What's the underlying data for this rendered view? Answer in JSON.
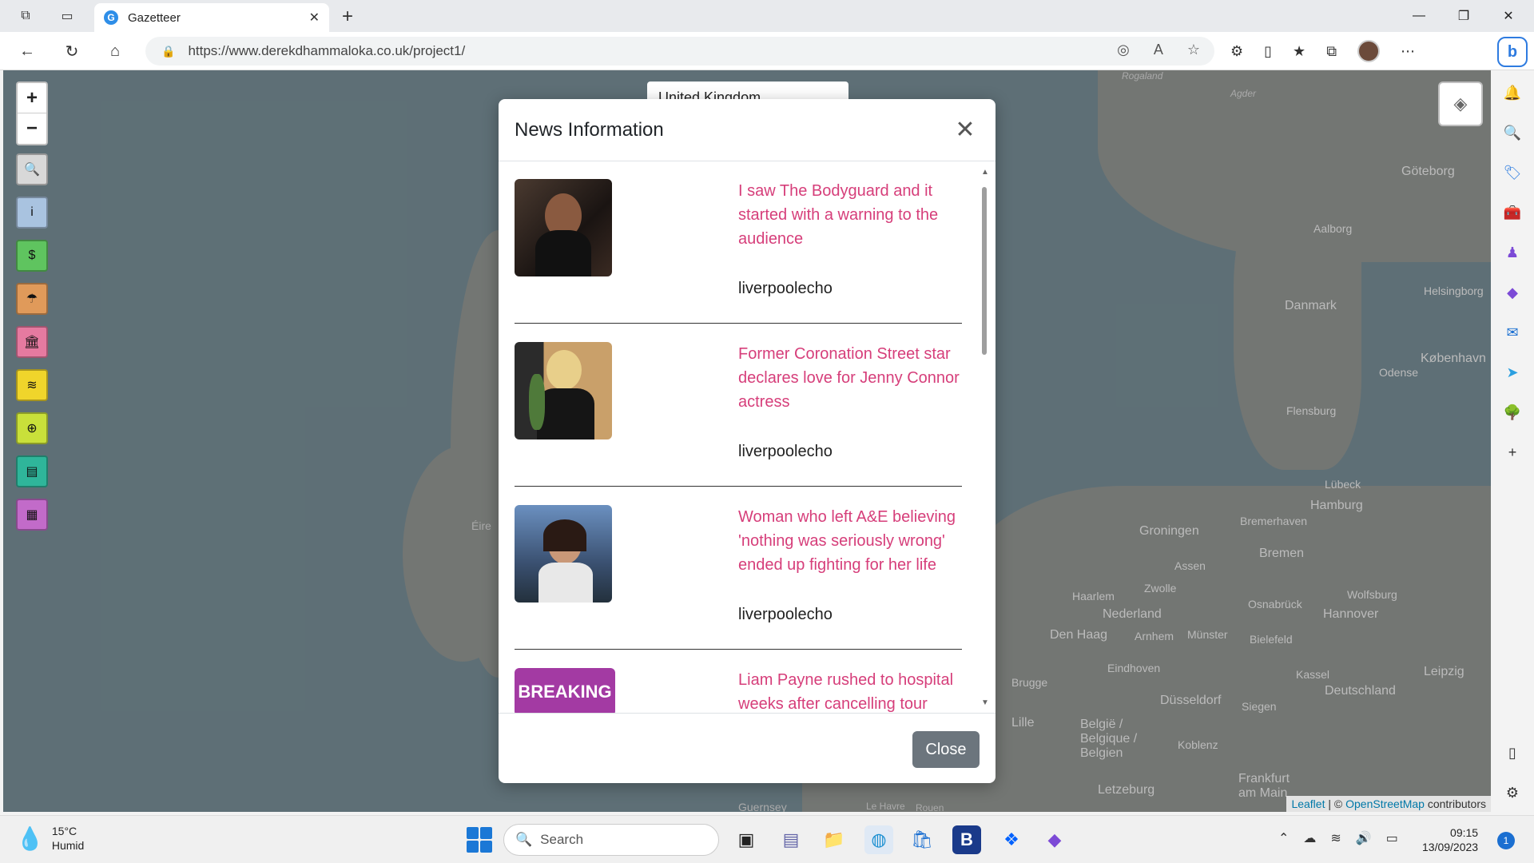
{
  "browser": {
    "tab_title": "Gazetteer",
    "tab_favicon": "G",
    "url": "https://www.derekdhammaloka.co.uk/project1/"
  },
  "map": {
    "country_select_value": "United Kingdom",
    "labels": [
      {
        "text": "Göteborg"
      },
      {
        "text": "Aalborg"
      },
      {
        "text": "Danmark"
      },
      {
        "text": "Helsingborg"
      },
      {
        "text": "København"
      },
      {
        "text": "Odense"
      },
      {
        "text": "Flensburg"
      },
      {
        "text": "Lübeck"
      },
      {
        "text": "Hamburg"
      },
      {
        "text": "Bremerhaven"
      },
      {
        "text": "Groningen"
      },
      {
        "text": "Bremen"
      },
      {
        "text": "Assen"
      },
      {
        "text": "Zwolle"
      },
      {
        "text": "Haarlem"
      },
      {
        "text": "Nederland"
      },
      {
        "text": "Osnabrück"
      },
      {
        "text": "Wolfsburg"
      },
      {
        "text": "Hannover"
      },
      {
        "text": "Den Haag"
      },
      {
        "text": "Arnhem"
      },
      {
        "text": "Münster"
      },
      {
        "text": "Bielefeld"
      },
      {
        "text": "Eindhoven"
      },
      {
        "text": "Kassel"
      },
      {
        "text": "Leipzig"
      },
      {
        "text": "Deutschland"
      },
      {
        "text": "Düsseldorf"
      },
      {
        "text": "Siegen"
      },
      {
        "text": "Brugge"
      },
      {
        "text": "Lille"
      },
      {
        "text": "België / Belgique / Belgien"
      },
      {
        "text": "Koblenz"
      },
      {
        "text": "Frankfurt am Main"
      },
      {
        "text": "Letzeburg"
      },
      {
        "text": "Éire"
      },
      {
        "text": "Rogaland"
      },
      {
        "text": "Agder"
      },
      {
        "text": "Guernsey"
      },
      {
        "text": "Le Havre"
      },
      {
        "text": "Rouen"
      }
    ],
    "attribution_leaflet": "Leaflet",
    "attribution_sep": " | © ",
    "attribution_osm": "OpenStreetMap",
    "attribution_suffix": " contributors"
  },
  "modal": {
    "title": "News Information",
    "close_label": "Close",
    "articles": [
      {
        "title": "I saw The Bodyguard and it started with a warning to the audience",
        "source": "liverpoolecho"
      },
      {
        "title": "Former Coronation Street star declares love for Jenny Connor actress",
        "source": "liverpoolecho"
      },
      {
        "title": "Woman who left A&E believing 'nothing was seriously wrong' ended up fighting for her life",
        "source": "liverpoolecho"
      },
      {
        "title": "Liam Payne rushed to hospital weeks after cancelling tour",
        "source": "",
        "thumb_text": "BREAKING"
      }
    ]
  },
  "taskbar": {
    "temperature": "15°C",
    "weather_desc": "Humid",
    "search_placeholder": "Search",
    "time": "09:15",
    "date": "13/09/2023",
    "notifications": "1"
  }
}
